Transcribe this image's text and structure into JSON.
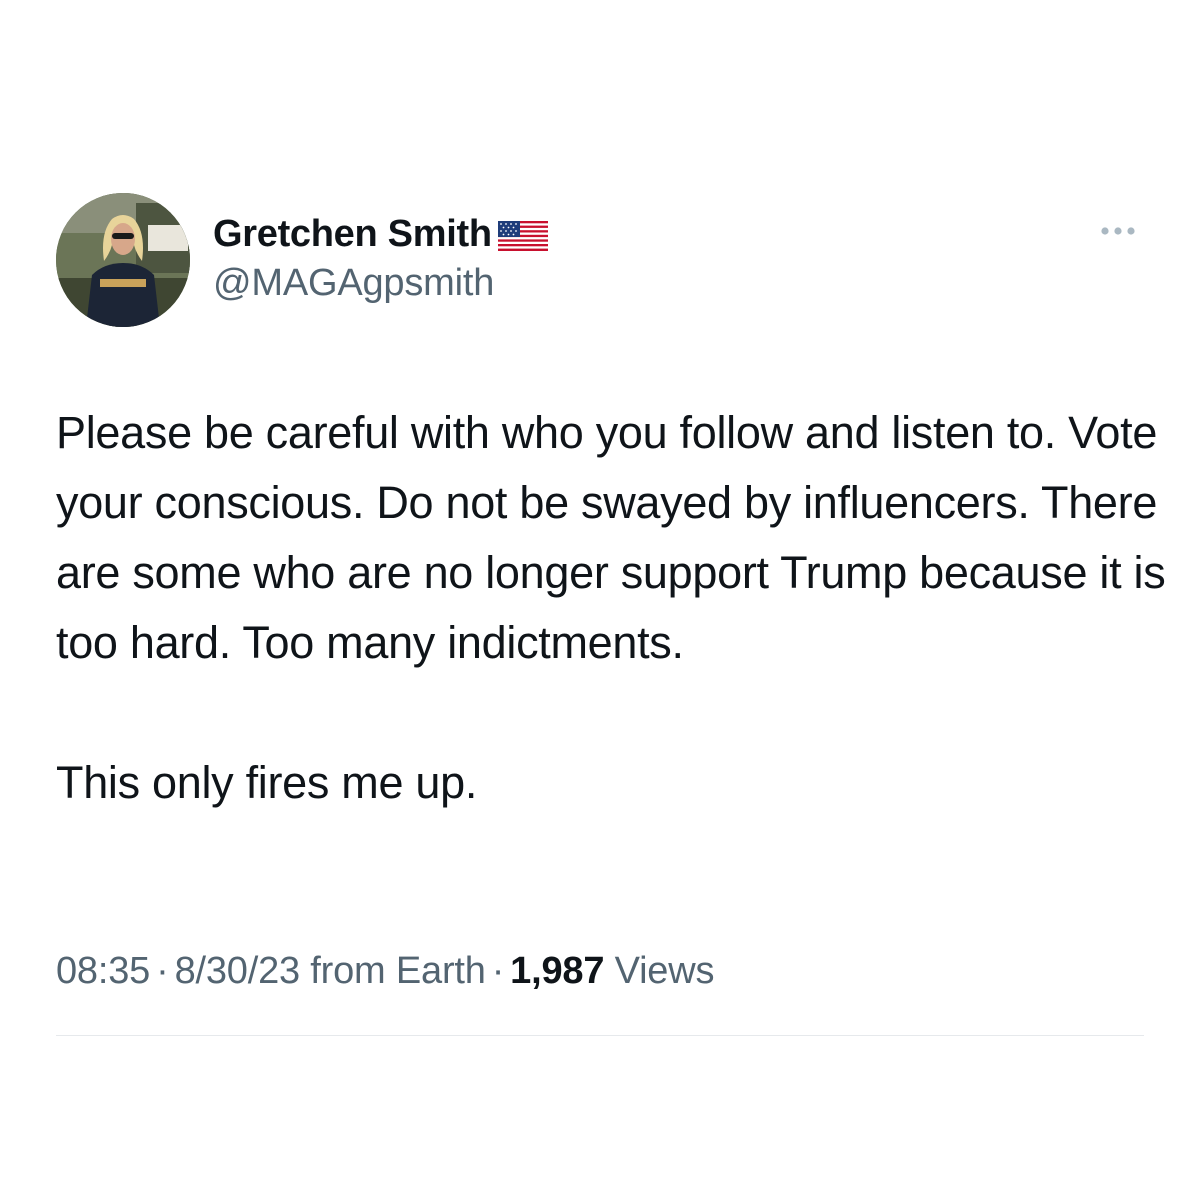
{
  "author": {
    "display_name": "Gretchen Smith",
    "handle": "@MAGAgpsmith",
    "avatar_icon": "profile-photo",
    "flag_icon": "us-flag-icon"
  },
  "more_icon": "more-options-icon",
  "tweet": {
    "paragraphs": [
      "Please be careful with who you follow and listen to. Vote your conscious. Do not be swayed by influencers. There are some who are no longer support Trump because it is too hard. Too many indictments.",
      "This only fires me up."
    ]
  },
  "meta": {
    "time": "08:35",
    "separator": "·",
    "date": "8/30/23 from Earth",
    "views_count": "1,987",
    "views_label": "Views"
  },
  "colors": {
    "text_primary": "#0f1419",
    "text_secondary": "#536471",
    "divider": "#e6e9ec"
  }
}
